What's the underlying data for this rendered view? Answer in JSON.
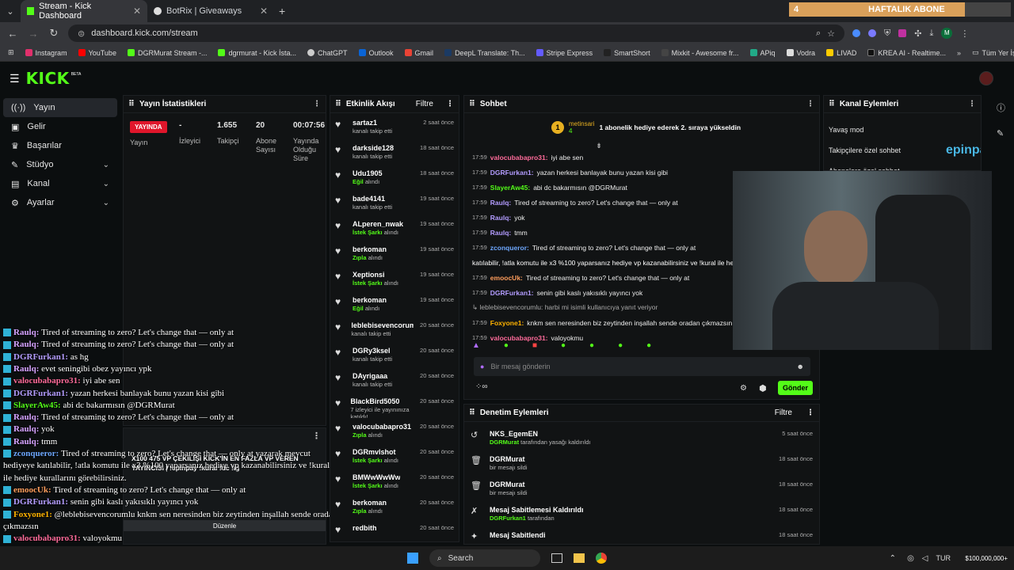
{
  "browser": {
    "tabs": [
      {
        "title": "Stream - Kick Dashboard",
        "active": true
      },
      {
        "title": "BotRix | Giveaways",
        "active": false
      }
    ],
    "url": "dashboard.kick.com/stream",
    "abone_bar": {
      "count": "4",
      "label": "HAFTALIK ABONE"
    },
    "bookmarks": [
      "Instagram",
      "YouTube",
      "DGRMurat Stream -...",
      "dgrmurat - Kick İsta...",
      "ChatGPT",
      "Outlook",
      "Gmail",
      "DeepL Translate: Th...",
      "Stripe Express",
      "SmartShort",
      "Mixkit - Awesome fr...",
      "APiq",
      "Vodra",
      "LIVAD",
      "KREA AI - Realtime..."
    ],
    "bookmarks_all": "Tüm Yer İşaretleri"
  },
  "app": {
    "logo": "KICK",
    "beta": "BETA"
  },
  "sidebar": {
    "items": [
      {
        "label": "Yayın",
        "icon": "broadcast-icon",
        "active": true
      },
      {
        "label": "Gelir",
        "icon": "money-icon"
      },
      {
        "label": "Başarılar",
        "icon": "trophy-icon"
      },
      {
        "label": "Stüdyo",
        "icon": "studio-icon",
        "expand": true
      },
      {
        "label": "Kanal",
        "icon": "channel-icon",
        "expand": true
      },
      {
        "label": "Ayarlar",
        "icon": "gear-icon",
        "expand": true
      }
    ]
  },
  "stats": {
    "title": "Yayın İstatistikleri",
    "live": "YAYINDA",
    "live_label": "Yayın",
    "viewers": "-",
    "viewers_label": "İzleyici",
    "followers": "1.655",
    "followers_label": "Takipçi",
    "subs": "20",
    "subs_label": "Abone Sayısı",
    "uptime": "00:07:56",
    "uptime_label": "Yayında Olduğu Süre"
  },
  "activity": {
    "title": "Etkinlik Akışı",
    "filter": "Filtre",
    "items": [
      {
        "name": "sartaz1",
        "sub": "kanalı takip etti",
        "hl": "",
        "time": "2 saat önce"
      },
      {
        "name": "darkside128",
        "sub": "kanalı takip etti",
        "hl": "",
        "time": "18 saat önce"
      },
      {
        "name": "Udu1905",
        "sub": "alındı",
        "hl": "Eğil",
        "time": "18 saat önce"
      },
      {
        "name": "bade4141",
        "sub": "kanalı takip etti",
        "hl": "",
        "time": "19 saat önce"
      },
      {
        "name": "ALperen_nwak",
        "sub": "alındı",
        "hl": "İstek Şarkı",
        "time": "19 saat önce"
      },
      {
        "name": "berkoman",
        "sub": "alındı",
        "hl": "Zıpla",
        "time": "19 saat önce"
      },
      {
        "name": "Xeptionsi",
        "sub": "alındı",
        "hl": "İstek Şarkı",
        "time": "19 saat önce"
      },
      {
        "name": "berkoman",
        "sub": "alındı",
        "hl": "Eğil",
        "time": "19 saat önce"
      },
      {
        "name": "leblebisevencorumlu",
        "sub": "kanalı takip etti",
        "hl": "",
        "time": "20 saat önce"
      },
      {
        "name": "DGRy3ksel",
        "sub": "kanalı takip etti",
        "hl": "",
        "time": "20 saat önce"
      },
      {
        "name": "DAyrigaaa",
        "sub": "kanalı takip etti",
        "hl": "",
        "time": "20 saat önce"
      },
      {
        "name": "BlackBird5050",
        "sub": "7 izleyici ile yayınınıza katıldı!",
        "hl": "",
        "time": "20 saat önce"
      },
      {
        "name": "valocubabapro31",
        "sub": "alındı",
        "hl": "Zıpla",
        "time": "20 saat önce"
      },
      {
        "name": "DGRmvlshot",
        "sub": "alındı",
        "hl": "İstek Şarkı",
        "time": "20 saat önce"
      },
      {
        "name": "BMWwWwWw",
        "sub": "alındı",
        "hl": "İstek Şarkı",
        "time": "20 saat önce"
      },
      {
        "name": "berkoman",
        "sub": "alındı",
        "hl": "Zıpla",
        "time": "20 saat önce"
      },
      {
        "name": "redbith",
        "sub": "",
        "hl": "",
        "time": "20 saat önce"
      }
    ]
  },
  "chat": {
    "title": "Sohbet",
    "pinned_user": "metinsari",
    "pinned_count": "4",
    "pinned_text": "1 abonelik hediye ederek 2. sıraya yükseldin",
    "messages": [
      {
        "time": "17:59",
        "user": "valocubabapro31",
        "color": "#ff6b9a",
        "text": "iyi abe sen"
      },
      {
        "time": "17:59",
        "user": "DGRFurkan1",
        "color": "#b39cff",
        "text": "yazan herkesi banlayak bunu yazan kisi gibi"
      },
      {
        "time": "17:59",
        "user": "SlayerAw45",
        "color": "#53fc18",
        "text": "abi dc bakarmısın @DGRMurat"
      },
      {
        "time": "17:59",
        "user": "Raulq",
        "color": "#b39cff",
        "text": "Tired of streaming to zero? Let's change that — only at"
      },
      {
        "time": "17:59",
        "user": "Raulq",
        "color": "#b39cff",
        "text": "yok"
      },
      {
        "time": "17:59",
        "user": "Raulq",
        "color": "#b39cff",
        "text": "tmm"
      },
      {
        "time": "17:59",
        "user": "zconqueror",
        "color": "#6ea8ff",
        "text": "Tired of streaming to zero? Let's change that — only at"
      },
      {
        "time": "",
        "user": "",
        "color": "#fff",
        "text": "katılabilir, !atla komutu ile x3 %100 yaparsanız hediye vp kazanabilirsiniz ve !kural ile hedi"
      },
      {
        "time": "17:59",
        "user": "emoocUk",
        "color": "#ff9d5c",
        "text": "Tired of streaming to zero? Let's change that — only at"
      },
      {
        "time": "17:59",
        "user": "DGRFurkan1",
        "color": "#b39cff",
        "text": "senin gibi kaslı yakısıklı yayıncı yok"
      },
      {
        "time": "",
        "user": "",
        "color": "#aaa",
        "text": "↳ leblebisevencorumlu: harbi mi isimli kullanıcıya yanıt veriyor"
      },
      {
        "time": "17:59",
        "user": "Foxyone1",
        "color": "#ffb300",
        "text": "knkm sen neresinden biz zeytinden inşallah sende oradan çıkmazsın"
      },
      {
        "time": "17:59",
        "user": "valocubabapro31",
        "color": "#ff6b9a",
        "text": "valoyokmu"
      }
    ],
    "placeholder": "Bir mesaj gönderin",
    "send": "Gönder"
  },
  "actions": {
    "title": "Kanal Eylemleri",
    "items": [
      "Yavaş mod",
      "Takipçilere özel sohbet",
      "Abonelere özel sohbet"
    ],
    "sponsor": "epinpay"
  },
  "moderation": {
    "title": "Denetim Eylemleri",
    "filter": "Filtre",
    "items": [
      {
        "name": "NKS_EgemEN",
        "hl": "DGRMurat",
        "sub": "tarafından yasağı kaldırıldı",
        "time": "5 saat önce"
      },
      {
        "name": "DGRMurat",
        "hl": "",
        "sub": "bir mesajı sildi",
        "time": "18 saat önce"
      },
      {
        "name": "DGRMurat",
        "hl": "",
        "sub": "bir mesajı sildi",
        "time": "18 saat önce"
      },
      {
        "name": "Mesaj Sabitlemesi Kaldırıldı",
        "hl": "DGRFurkan1",
        "sub": "tarafından",
        "time": "18 saat önce"
      },
      {
        "name": "Mesaj Sabitlendi",
        "hl": "",
        "sub": "",
        "time": "18 saat önce"
      }
    ]
  },
  "overlay": {
    "giveaway": "X100 475 VP ÇEKİLİŞİ KICK'İN EN FAZLA VP VEREN YAYINCISI | !epinpay !kural !dc !ig",
    "edit": "Düzenle",
    "lines": [
      {
        "user": "Raulq",
        "color": "#d6a3ff",
        "text": "Tired of streaming to zero? Let's change that — only at"
      },
      {
        "user": "Raulq",
        "color": "#d6a3ff",
        "text": "Tired of streaming to zero? Let's change that — only at"
      },
      {
        "user": "DGRFurkan1",
        "color": "#b39cff",
        "text": "as hg"
      },
      {
        "user": "Raulq",
        "color": "#d6a3ff",
        "text": "evet seningibi obez yayıncı ypk"
      },
      {
        "user": "valocubabapro31",
        "color": "#ff6b9a",
        "text": "iyi abe sen"
      },
      {
        "user": "DGRFurkan1",
        "color": "#b39cff",
        "text": "yazan herkesi banlayak bunu yazan kisi gibi"
      },
      {
        "user": "SlayerAw45",
        "color": "#53fc18",
        "text": "abi dc bakarmısın @DGRMurat"
      },
      {
        "user": "Raulq",
        "color": "#d6a3ff",
        "text": "Tired of streaming to zero? Let's change that — only at"
      },
      {
        "user": "Raulq",
        "color": "#d6a3ff",
        "text": "yok"
      },
      {
        "user": "Raulq",
        "color": "#d6a3ff",
        "text": "tmm"
      },
      {
        "user": "zconqueror",
        "color": "#6ea8ff",
        "text": "Tired of streaming to zero? Let's change that — only at yazarak mevcut"
      },
      {
        "user": "",
        "color": "#fff",
        "text": "hediyeye katılabilir, !atla komutu ile x3 %100 yaparsanız hediye vp kazanabilirsiniz ve !kural"
      },
      {
        "user": "",
        "color": "#fff",
        "text": "ile hediye kurallarını görebilirsiniz."
      },
      {
        "user": "emoocUk",
        "color": "#ff9d5c",
        "text": "Tired of streaming to zero? Let's change that — only at"
      },
      {
        "user": "DGRFurkan1",
        "color": "#b39cff",
        "text": "senin gibi kaslı yakısıklı yayıncı yok"
      },
      {
        "user": "Foxyone1",
        "color": "#ffb300",
        "text": "@leblebisevencorumlu knkm sen neresinden biz zeytinden inşallah sende oradan"
      },
      {
        "user": "",
        "color": "#fff",
        "text": "çıkmazsın"
      },
      {
        "user": "valocubabapro31",
        "color": "#ff6b9a",
        "text": "valoyokmu"
      }
    ]
  },
  "taskbar": {
    "search": "Search",
    "lang": "TUR",
    "widget": "$100,000,000+"
  },
  "colors": {
    "accent": "#53fc18",
    "live": "#e0162b",
    "bg": "#0b0e0f",
    "panel": "#111314"
  }
}
